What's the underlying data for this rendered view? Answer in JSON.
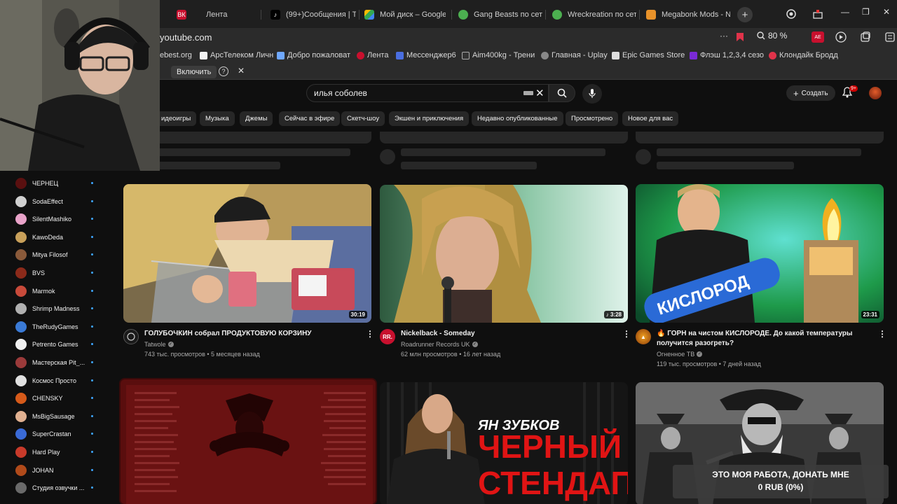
{
  "browser": {
    "tabs": [
      {
        "label": "Лента",
        "icon": "vk-play-icon"
      },
      {
        "label": "(99+)Сообщения | T",
        "icon": "tiktok-icon"
      },
      {
        "label": "Мой диск – Google",
        "icon": "google-drive-icon"
      },
      {
        "label": "Gang Beasts по сет",
        "icon": "game-icon"
      },
      {
        "label": "Wreckreation по сет",
        "icon": "game-icon"
      },
      {
        "label": "Megabonk Mods - N",
        "icon": "nexus-icon"
      }
    ],
    "url": "youtube.com",
    "zoom": "80 %",
    "bookmarks": [
      "ebest.org",
      "АрсТелеком Личн",
      "Добро пожаловат",
      "Лента",
      "Мессенджер6",
      "Aim400kg - Трени",
      "Главная - Uplay",
      "Epic Games Store",
      "Флэш 1,2,3,4 сезо",
      "Клондайк Бродд"
    ],
    "infobar": {
      "enable_label": "Включить"
    }
  },
  "header": {
    "search_query": "илья соболев",
    "create_label": "Создать",
    "notif_badge": "9+"
  },
  "chips": [
    "идеоигры",
    "Музыка",
    "Джемы",
    "Сейчас в эфире",
    "Скетч-шоу",
    "Экшен и приключения",
    "Недавно опубликованные",
    "Просмотрено",
    "Новое для вас"
  ],
  "sidebar": {
    "subscriptions": [
      {
        "name": "ЧЕРНЕЦ",
        "color": "#5a1010"
      },
      {
        "name": "SodaEffect",
        "color": "#d0d0d0"
      },
      {
        "name": "SilentMashiko",
        "color": "#e9a3c9"
      },
      {
        "name": "KawoDeda",
        "color": "#c8a05a"
      },
      {
        "name": "Mitya Filosof",
        "color": "#8a5a3a"
      },
      {
        "name": "BVS",
        "color": "#8b2a1a"
      },
      {
        "name": "Marmok",
        "color": "#c84a3a"
      },
      {
        "name": "Shrimp Madness",
        "color": "#b0b0b0"
      },
      {
        "name": "TheRudyGames",
        "color": "#3a7ad6"
      },
      {
        "name": "Petrento Games",
        "color": "#f0f0f0"
      },
      {
        "name": "Мастерская Pit_...",
        "color": "#9a3a3a"
      },
      {
        "name": "Космос Просто",
        "color": "#e0e0e0"
      },
      {
        "name": "CHENSKY",
        "color": "#d65a1a"
      },
      {
        "name": "MsBigSausage",
        "color": "#e0b090"
      },
      {
        "name": "SuperCrastan",
        "color": "#3a6ad6"
      },
      {
        "name": "Hard Play",
        "color": "#c83a2a"
      },
      {
        "name": "JOHAN",
        "color": "#b04a1a"
      },
      {
        "name": "Студия озвучки ...",
        "color": "#6a6a6a"
      }
    ]
  },
  "videos": [
    {
      "title": "ГОЛУБОЧКИН собрал ПРОДУКТОВУЮ КОРЗИНУ",
      "channel": "Tatwole",
      "verified": true,
      "meta": "743 тыс. просмотров • 5 месяцев назад",
      "duration": "30:19",
      "avatar_text": ""
    },
    {
      "title": "Nickelback - Someday",
      "channel": "Roadrunner Records UK",
      "verified": true,
      "meta": "62 млн просмотров • 16 лет назад",
      "duration": "3:28",
      "avatar_text": "RR."
    },
    {
      "title_line1": "🔥 ГОРН на чистом КИСЛОРОДЕ. До какой температуры",
      "title_line2": "получится разогреть?",
      "channel": "Огненное ТВ",
      "verified": true,
      "meta": "119 тыс. просмотров • 7 дней назад",
      "duration": "23:31",
      "thumb_text": "КИСЛОРОД"
    }
  ],
  "row2": {
    "standup_author": "ЯН ЗУБКОВ",
    "standup_line1": "ЧЕРНЫЙ",
    "standup_line2": "СТЕНДАП"
  },
  "donate": {
    "line1": "ЭТО МОЯ РАБОТА, ДОНАТЬ МНЕ",
    "line2": "0 RUB (0%)"
  }
}
